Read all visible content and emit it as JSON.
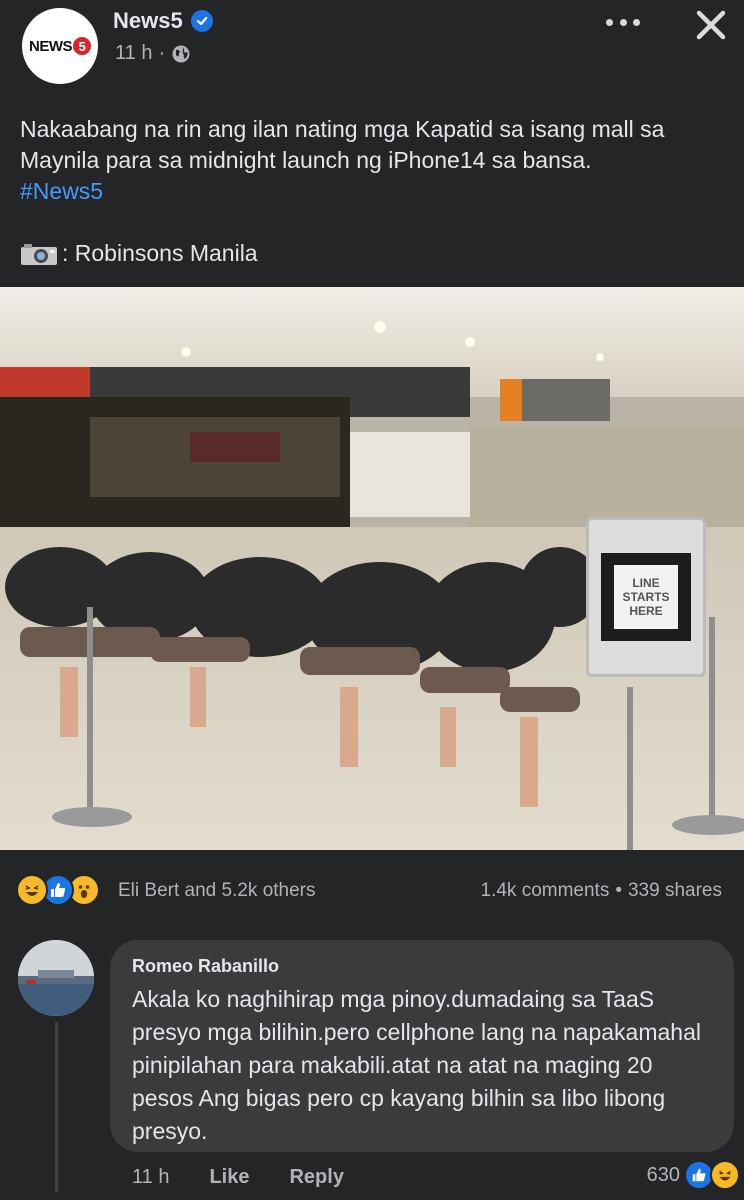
{
  "post": {
    "page_name": "News5",
    "avatar_logo_text": "NEWS",
    "avatar_logo_number": "5",
    "time": "11 h",
    "separator": "·",
    "text": "Nakaabang na rin ang ilan nating mga Kapatid sa isang mall sa Maynila para sa midnight launch ng iPhone14 sa bansa.",
    "hashtag": "#News5",
    "photo_credit": ": Robinsons Manila",
    "photo_sign_text": [
      "LINE",
      "STARTS",
      "HERE"
    ]
  },
  "reactions": {
    "icons": [
      "haha-icon",
      "like-icon",
      "wow-icon"
    ],
    "summary": "Eli Bert and 5.2k others",
    "comments": "1.4k comments",
    "dot": "•",
    "shares": "339 shares"
  },
  "comment": {
    "author": "Romeo Rabanillo",
    "body": "Akala ko naghihirap mga pinoy.dumadaing sa TaaS presyo mga bilihin.pero cellphone lang na napakamahal pinipilahan para makabili.atat na atat na maging 20 pesos Ang bigas pero cp kayang bilhin sa libo libong presyo.",
    "time": "11 h",
    "like_label": "Like",
    "reply_label": "Reply",
    "reaction_count": "630"
  },
  "colors": {
    "background": "#242526",
    "bubble": "#3a3b3c",
    "text_primary": "#e4e6eb",
    "text_secondary": "#b0b3b8",
    "link": "#4599ff",
    "facebook_blue": "#1b74e4",
    "reaction_yellow": "#f7b928"
  }
}
